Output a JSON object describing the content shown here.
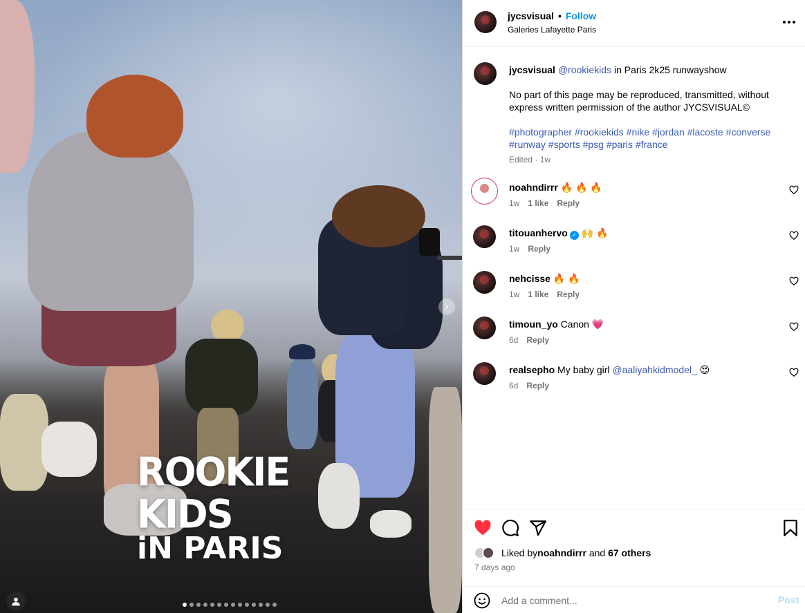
{
  "post": {
    "username": "jycsvisual",
    "follow_label": "Follow",
    "separator": "•",
    "location": "Galeries Lafayette Paris",
    "more_icon": "more-horizontal-icon"
  },
  "media": {
    "overlay_line1": "ROOKIE KIDS",
    "overlay_line2": "iN PARIS",
    "carousel_count": 14,
    "carousel_active_index": 0
  },
  "caption": {
    "username": "jycsvisual",
    "mention": "@rookiekids",
    "text": " in Paris 2k25 runwayshow",
    "paragraph": "No part of this page may be reproduced, transmitted, without express written permission of the author JYCSVISUAL©",
    "hashtags_line1": "#photographer #rookiekids #nike #jordan #lacoste #converse",
    "hashtags_line2": "#runway #sports #psg #paris #france",
    "meta": "Edited · 1w"
  },
  "comments": [
    {
      "username": "noahndirrr",
      "text": "🔥 🔥 🔥",
      "time": "1w",
      "likes": "1 like",
      "reply": "Reply"
    },
    {
      "username": "titouanhervo",
      "verified": true,
      "text": "🙌 🔥",
      "time": "1w",
      "likes": "",
      "reply": "Reply"
    },
    {
      "username": "nehcisse",
      "text": "🔥 🔥",
      "time": "1w",
      "likes": "1 like",
      "reply": "Reply"
    },
    {
      "username": "timoun_yo",
      "text": "Canon 💗",
      "time": "6d",
      "likes": "",
      "reply": "Reply"
    },
    {
      "username": "realsepho",
      "text": "My baby girl ",
      "mention": "@aaliyahkidmodel_",
      "emoji": " 😍",
      "time": "6d",
      "likes": "",
      "reply": "Reply"
    }
  ],
  "likes": {
    "prefix": "Liked by ",
    "user": "noahndirrr",
    "middle": " and ",
    "others": "67 others"
  },
  "posted_ago": "7 days ago",
  "add_comment": {
    "placeholder": "Add a comment...",
    "post_label": "Post"
  },
  "colors": {
    "like_red": "#ff3040",
    "link_blue": "#3a5bb5",
    "follow_blue": "#0095f6",
    "post_disabled": "#b2dffc"
  }
}
